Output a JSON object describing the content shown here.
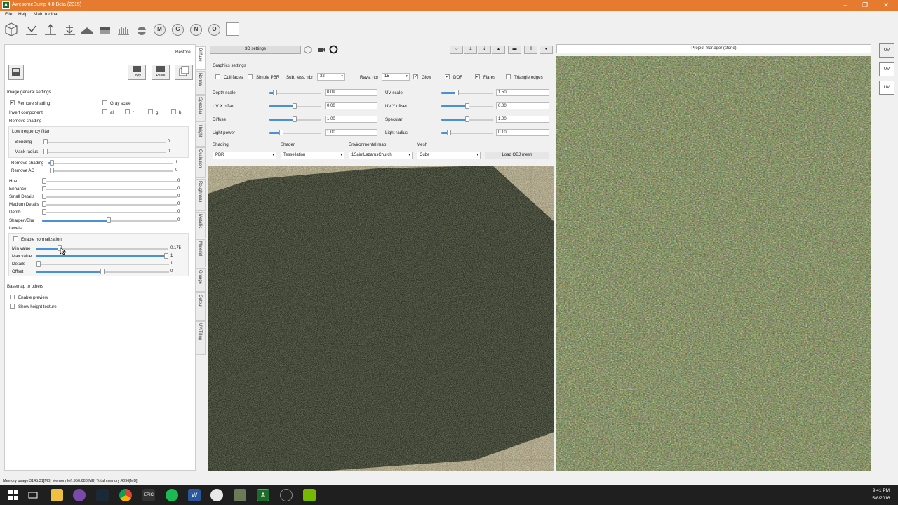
{
  "window": {
    "title": "AwesomeBump 4.0 Beta (2015)",
    "app_icon": "awesomebump-icon",
    "minimize": "–",
    "maximize": "❐",
    "close": "✕"
  },
  "menu": [
    "File",
    "Help",
    "Main toolbar"
  ],
  "toolbar_icons": [
    "cube-icon",
    "diffuse-icon",
    "normal-icon",
    "specular-icon",
    "height-icon",
    "occlusion-icon",
    "roughness-icon",
    "metallic-icon",
    "M",
    "G",
    "N",
    "O",
    "material-icon"
  ],
  "left": {
    "restore": "Restore",
    "copy": "Copy",
    "paste": "Paste",
    "image_general": "Image general settings",
    "remove_shading_chk": "Remove shading",
    "gray_scale": "Gray scale",
    "invert_component": "Invert component",
    "inv_all": "all",
    "inv_r": "r",
    "inv_g": "g",
    "inv_b": "b",
    "remove_shading_title": "Remove shading",
    "low_freq": "Low frequency filter",
    "blending": "Blending",
    "blending_val": "0",
    "mask_radius": "Mask radius",
    "mask_radius_val": "0",
    "remove_shading": "Remove shading",
    "remove_shading_val": "1",
    "remove_ao": "Remove AO",
    "remove_ao_val": "0",
    "hue": "Hue",
    "hue_val": "0",
    "enhance": "Enhance",
    "enhance_val": "0",
    "small_details": "Small Details",
    "small_details_val": "0",
    "medium_details": "Medium Details",
    "medium_details_val": "0",
    "depth": "Depth",
    "depth_val": "0",
    "sharpen_blur": "Sharpen/Blur",
    "sharpen_blur_val": "0",
    "levels": "Levels",
    "enable_normalization": "Enable normalization",
    "min_value": "Min value",
    "min_value_val": "0.175",
    "max_value": "Max value",
    "max_value_val": "1",
    "details": "Details",
    "details_val": "1",
    "offset": "Offset",
    "offset_val": "0",
    "basemap": "Basemap to others",
    "enable_preview": "Enable preview",
    "show_height": "Show height texture"
  },
  "tabs": [
    "Diffuse",
    "Normal",
    "Specular",
    "Height",
    "Occlusion",
    "Roughness",
    "Metallic",
    "Material",
    "Grunge",
    "Output",
    "UV/Tiling"
  ],
  "center": {
    "settings_3d": "3D settings",
    "graphics_settings": "Graphics settings",
    "cull_faces": "Cull faces",
    "simple_pbr": "Simple PBR",
    "sub_tess": "Sub. tess. nbr",
    "sub_tess_val": "32",
    "rays": "Rays. nbr",
    "rays_val": "15",
    "glow": "Glow",
    "dof": "DOF",
    "flares": "Flares",
    "triangle_edges": "Triangle edges",
    "depth_scale": "Depth scale",
    "depth_scale_val": "0.09",
    "uv_scale": "UV scale",
    "uv_scale_val": "1.50",
    "uvx": "UV X offset",
    "uvx_val": "0.00",
    "uvy": "UV Y offset",
    "uvy_val": "0.00",
    "diffuse": "Diffuse",
    "diffuse_val": "1.00",
    "specular": "Specular",
    "specular_val": "1.00",
    "light_power": "Light power",
    "light_power_val": "1.00",
    "light_radius": "Light radius",
    "light_radius_val": "0.10",
    "shading": "Shading",
    "shading_val": "PBR",
    "shader": "Shader",
    "shader_val": "Tessellation",
    "env_map": "Environmental map",
    "env_map_val": "1SaintLazarusChurch",
    "mesh": "Mesh",
    "mesh_val": "Cube",
    "load_obj": "Load OBJ mesh"
  },
  "right": {
    "project_manager": "Project manager (stone)",
    "uv_labels": [
      "UV",
      "UV",
      "UV"
    ]
  },
  "status": "Memory usage:3145.31[MB] Memory left:950.688[MB] Total memory:4096[MB]",
  "clock": {
    "time": "9:41 PM",
    "date": "5/8/2016"
  },
  "taskbar_icons": [
    "windows-start-icon",
    "task-view-icon",
    "file-explorer-icon",
    "app-icon",
    "steam-icon",
    "epic-games-icon",
    "spotify-icon",
    "word-icon",
    "media-player-icon",
    "chrome-icon",
    "image-icon",
    "awesomebump-taskbar-icon",
    "unreal-icon",
    "nvidia-icon"
  ],
  "colors": {
    "titlebar": "#e67b2f",
    "accent": "#4a90d9",
    "taskbar": "#1f1f1f"
  }
}
